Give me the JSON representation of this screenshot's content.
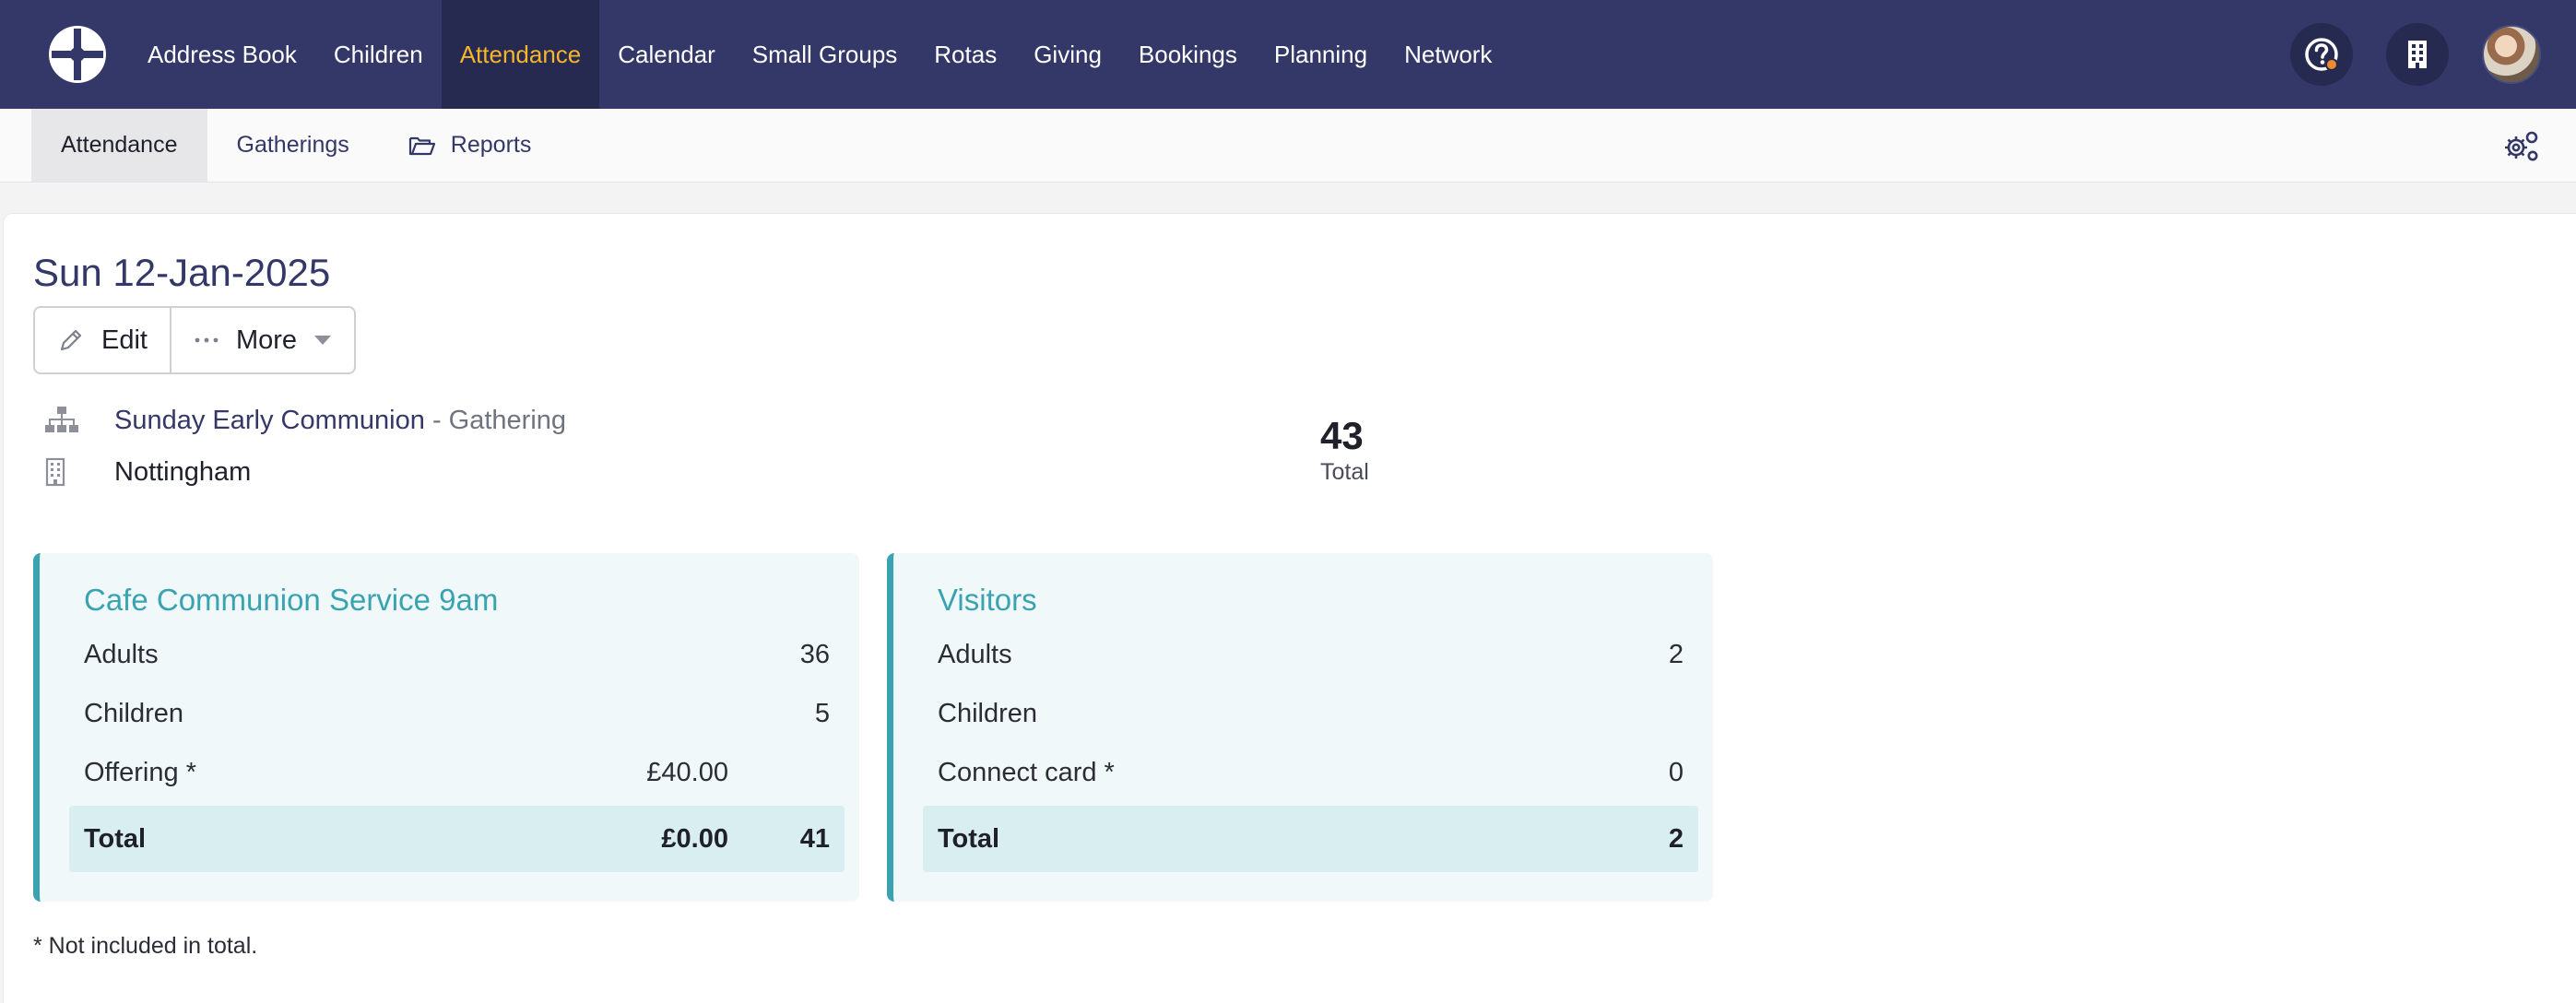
{
  "topnav": {
    "items": [
      {
        "label": "Address Book"
      },
      {
        "label": "Children"
      },
      {
        "label": "Attendance",
        "active": true
      },
      {
        "label": "Calendar"
      },
      {
        "label": "Small Groups"
      },
      {
        "label": "Rotas"
      },
      {
        "label": "Giving"
      },
      {
        "label": "Bookings"
      },
      {
        "label": "Planning"
      },
      {
        "label": "Network"
      }
    ],
    "icons": [
      "help-icon",
      "building-icon",
      "avatar"
    ]
  },
  "subnav": {
    "items": [
      {
        "label": "Attendance",
        "active": true
      },
      {
        "label": "Gatherings"
      },
      {
        "label": "Reports",
        "icon": "folder-open-icon"
      }
    ],
    "settings_icon": "gears-icon"
  },
  "page": {
    "title": "Sun 12-Jan-2025",
    "buttons": {
      "edit": "Edit",
      "more": "More"
    },
    "gathering_name": "Sunday Early Communion",
    "gathering_suffix": " - Gathering",
    "location": "Nottingham",
    "total_value": "43",
    "total_label": "Total"
  },
  "panels": [
    {
      "title": "Cafe Communion Service 9am",
      "rows": [
        {
          "label": "Adults",
          "amount": "",
          "count": "36"
        },
        {
          "label": "Children",
          "amount": "",
          "count": "5"
        },
        {
          "label": "Offering *",
          "amount": "£40.00",
          "count": ""
        }
      ],
      "total": {
        "label": "Total",
        "amount": "£0.00",
        "count": "41"
      }
    },
    {
      "title": "Visitors",
      "rows": [
        {
          "label": "Adults",
          "amount": "",
          "count": "2"
        },
        {
          "label": "Children",
          "amount": "",
          "count": ""
        },
        {
          "label": "Connect card *",
          "amount": "",
          "count": "0"
        }
      ],
      "total": {
        "label": "Total",
        "amount": "",
        "count": "2"
      }
    }
  ],
  "footnote": "* Not included in total.",
  "colors": {
    "nav_bg": "#343868",
    "nav_active_bg": "#262a50",
    "nav_active_text": "#f7b52b",
    "accent_teal": "#3aa3b2",
    "panel_bg": "#f1f8f9",
    "panel_total_bg": "#d8eef1",
    "notification_dot": "#f08a2c"
  }
}
